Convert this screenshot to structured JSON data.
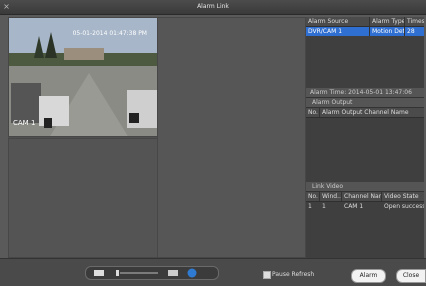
{
  "window": {
    "title": "Alarm Link"
  },
  "video": {
    "cam_label": "CAM 1",
    "osd_time": "05-01-2014 01:47:38 PM"
  },
  "alarm_table": {
    "headers": [
      "Alarm Source",
      "Alarm Type",
      "Times"
    ],
    "rows": [
      [
        "DVR/CAM 1",
        "Motion Det...",
        "28"
      ]
    ]
  },
  "alarm_time": "Alarm Time: 2014-05-01 13:47:06",
  "alarm_output": {
    "title": "Alarm Output",
    "headers": [
      "No.",
      "Alarm Output Channel Name"
    ]
  },
  "link_video": {
    "title": "Link Video",
    "headers": [
      "No.",
      "Wind..",
      "Channel Name",
      "Video State"
    ],
    "rows": [
      [
        "1",
        "1",
        "CAM 1",
        "Open success"
      ]
    ]
  },
  "bottom": {
    "pause_refresh": "Pause Refresh",
    "alarm_btn": "Alarm",
    "close_btn": "Close Video"
  }
}
